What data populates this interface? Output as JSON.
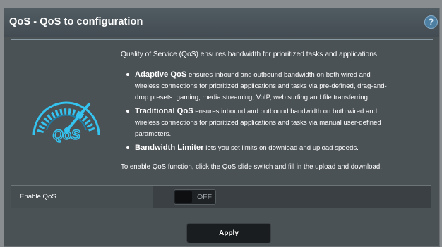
{
  "header": {
    "title": "QoS - QoS to configuration",
    "help_icon": "?"
  },
  "logo": {
    "icon": "qos-speedometer",
    "text": "QoS"
  },
  "description": {
    "intro": "Quality of Service (QoS) ensures bandwidth for prioritized tasks and applications.",
    "items": [
      {
        "term": "Adaptive QoS",
        "line1": " ensures inbound and outbound bandwidth on both wired and",
        "line2": "wireless connections for prioritized applications and tasks via pre-defined, drag-and-",
        "line3": "drop presets: gaming, media streaming, VoIP, web surfing and file transferring."
      },
      {
        "term": "Traditional QoS",
        "line1": " ensures inbound and outbound bandwidth on both wired and",
        "line2": "wireless connections for prioritized applications and tasks via manual user-defined",
        "line3": "parameters."
      },
      {
        "term": "Bandwidth Limiter",
        "line1": " lets you set limits on download and upload speeds."
      }
    ],
    "enable_note": "To enable QoS function, click the QoS slide switch and fill in the upload and download."
  },
  "settings": {
    "enable_qos_label": "Enable QoS",
    "toggle_state": "OFF"
  },
  "actions": {
    "apply_label": "Apply"
  },
  "colors": {
    "background": "#4b5256",
    "accent_cyan": "#35c3f0",
    "apply_button": "#1a1d1f"
  }
}
